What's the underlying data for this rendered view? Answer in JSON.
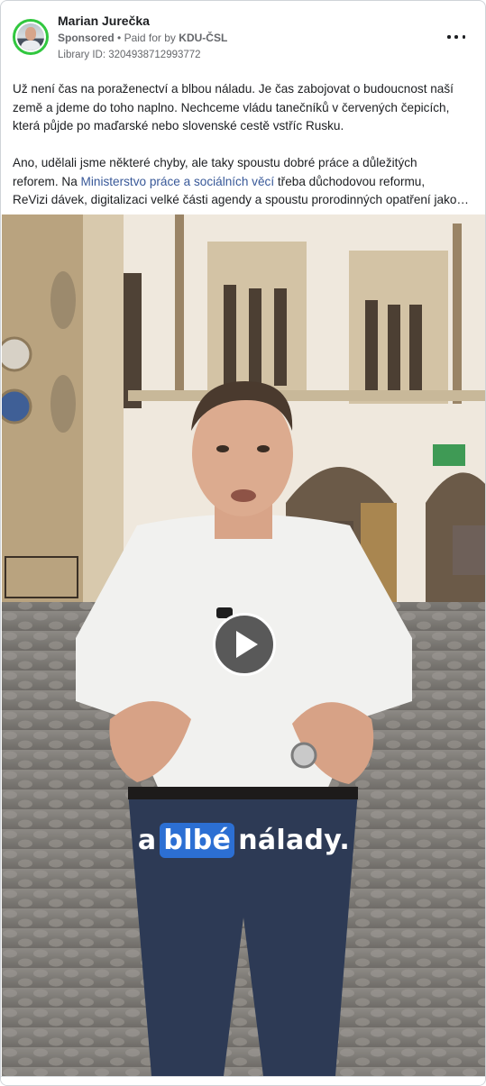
{
  "ad": {
    "advertiser_name": "Marian Jurečka",
    "sponsored_label": "Sponsored",
    "separator": "•",
    "paid_for_prefix": "Paid for by",
    "payer": "KDU-ČSL",
    "library_id": "Library ID: 3204938712993772",
    "more_icon": "more-horizontal-icon"
  },
  "post": {
    "paragraph1_line1": "Už není čas na poraženectví a blbou náladu. Je čas zabojovat o budoucnost naší",
    "paragraph1_line2": "země a jdeme do toho naplno. Nechceme vládu tanečníků v červených čepicích,",
    "paragraph1_line3": "která půjde po maďarské nebo slovenské cestě vstříc Rusku.",
    "paragraph2_line1": "Ano, udělali jsme některé chyby, ale taky spoustu dobré práce a důležitých",
    "paragraph2_line2_before": "reforem. Na ",
    "paragraph2_line2_link": "Ministerstvo práce a sociálních věcí",
    "paragraph2_line2_after": " třeba důchodovou reformu,",
    "paragraph2_line3": "ReVizi dávek, digitalizaci velké části agendy a spoustu prorodinných opatření jako…"
  },
  "video": {
    "play_icon": "play-icon",
    "caption_word1": "a",
    "caption_word2": "blbé",
    "caption_word3": "nálady."
  },
  "colors": {
    "avatar_ring": "#31c73f",
    "link": "#385898",
    "caption_highlight": "#2c6fd3"
  }
}
